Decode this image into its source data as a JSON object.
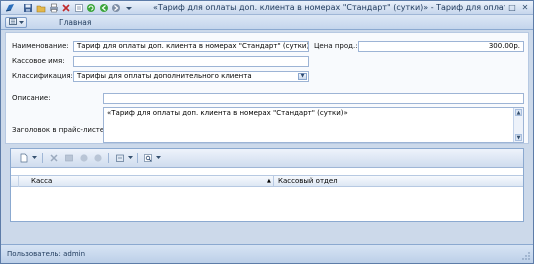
{
  "window": {
    "title": "«Тариф для оплаты доп. клиента в номерах \"Стандарт\" (сутки)» - Тариф для оплаты",
    "min_glyph": "–",
    "max_glyph": "□",
    "close_glyph": "✕"
  },
  "ribbon": {
    "tab_main": "Главная"
  },
  "form": {
    "name_label": "Наименование:",
    "name_value": "Тариф для оплаты доп. клиента в номерах \"Стандарт\" (сутки)",
    "price_label": "Цена прод.:",
    "price_value": "300.00р.",
    "cash_name_label": "Кассовое имя:",
    "cash_name_value": "",
    "classification_label": "Классификация:",
    "classification_value": "Тарифы для оплаты дополнительного клиента",
    "description_label": "Описание:",
    "description_value": "",
    "pricelist_header_label": "Заголовок в прайс-листе:",
    "pricelist_header_value": "«Тариф для оплаты доп. клиента в номерах \"Стандарт\" (сутки)»"
  },
  "grid": {
    "columns": [
      {
        "label": "Касса",
        "sort_glyph": "▲"
      },
      {
        "label": "Кассовый отдел"
      }
    ],
    "rows": []
  },
  "status": {
    "user_text": "Пользователь: admin"
  },
  "colors": {
    "frame": "#5d7ca8",
    "accent": "#8ba9d0",
    "background": "#ccd9ea"
  }
}
